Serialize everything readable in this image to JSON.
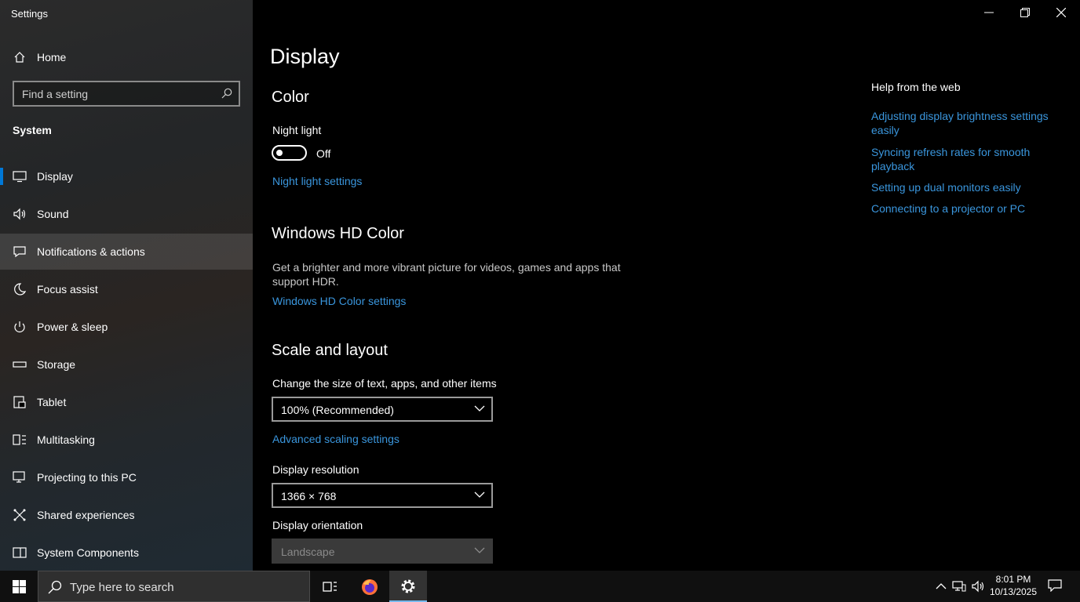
{
  "window": {
    "title": "Settings"
  },
  "sidebar": {
    "home_label": "Home",
    "search_placeholder": "Find a setting",
    "section_label": "System",
    "items": [
      {
        "label": "Display",
        "icon": "monitor-icon",
        "selected": true
      },
      {
        "label": "Sound",
        "icon": "speaker-icon"
      },
      {
        "label": "Notifications & actions",
        "icon": "notification-icon",
        "hovered": true
      },
      {
        "label": "Focus assist",
        "icon": "moon-icon"
      },
      {
        "label": "Power & sleep",
        "icon": "power-icon"
      },
      {
        "label": "Storage",
        "icon": "storage-icon"
      },
      {
        "label": "Tablet",
        "icon": "tablet-icon"
      },
      {
        "label": "Multitasking",
        "icon": "multitasking-icon"
      },
      {
        "label": "Projecting to this PC",
        "icon": "projecting-icon"
      },
      {
        "label": "Shared experiences",
        "icon": "shared-experiences-icon"
      },
      {
        "label": "System Components",
        "icon": "system-components-icon"
      }
    ]
  },
  "main": {
    "page_title": "Display",
    "color": {
      "heading": "Color",
      "night_light_label": "Night light",
      "night_light_state": "Off",
      "night_light_settings_link": "Night light settings"
    },
    "hd_color": {
      "heading": "Windows HD Color",
      "description": "Get a brighter and more vibrant picture for videos, games and apps that support HDR.",
      "settings_link": "Windows HD Color settings"
    },
    "scale_layout": {
      "heading": "Scale and layout",
      "scale_label": "Change the size of text, apps, and other items",
      "scale_value": "100% (Recommended)",
      "advanced_link": "Advanced scaling settings",
      "resolution_label": "Display resolution",
      "resolution_value": "1366 × 768",
      "orientation_label": "Display orientation",
      "orientation_value": "Landscape"
    }
  },
  "help": {
    "title": "Help from the web",
    "links": [
      "Adjusting display brightness settings easily",
      "Syncing refresh rates for smooth playback",
      "Setting up dual monitors easily",
      "Connecting to a projector or PC"
    ]
  },
  "taskbar": {
    "search_placeholder": "Type here to search",
    "time": "8:01 PM",
    "date": "10/13/2025"
  },
  "colors": {
    "accent": "#0078d7",
    "link": "#3a96dd",
    "background": "#000000"
  }
}
